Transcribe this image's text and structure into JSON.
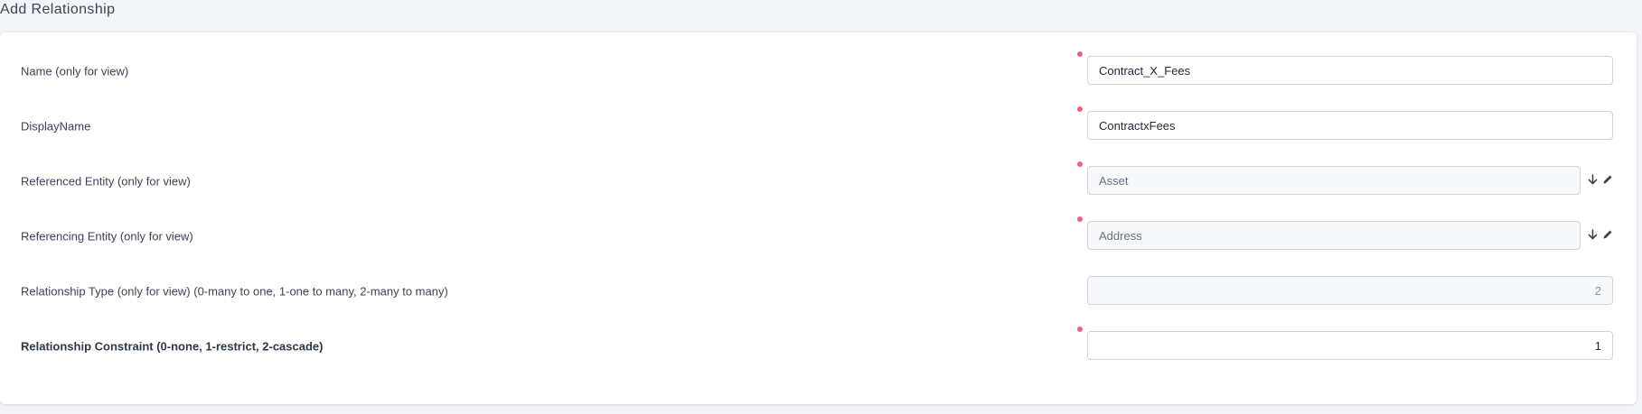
{
  "page": {
    "title": "Add Relationship"
  },
  "form": {
    "name": {
      "label": "Name (only for view)",
      "value": "Contract_X_Fees"
    },
    "display_name": {
      "label": "DisplayName",
      "value": "ContractxFees"
    },
    "referenced_entity": {
      "label": "Referenced Entity (only for view)",
      "value": "Asset"
    },
    "referencing_entity": {
      "label": "Referencing Entity (only for view)",
      "value": "Address"
    },
    "relationship_type": {
      "label": "Relationship Type (only for view) (0-many to one, 1-one to many, 2-many to many)",
      "value": "2"
    },
    "relationship_constraint": {
      "label": "Relationship Constraint (0-none, 1-restrict, 2-cascade)",
      "value": "1"
    }
  },
  "icons": {
    "required": "required-dot-icon",
    "select": "arrow-down-icon",
    "edit": "pencil-icon"
  },
  "colors": {
    "background": "#f3f4f7",
    "card": "#ffffff",
    "required_dot": "#f0607a",
    "input_border": "#cfd4dc",
    "readonly_bg": "#f7f8fa"
  }
}
